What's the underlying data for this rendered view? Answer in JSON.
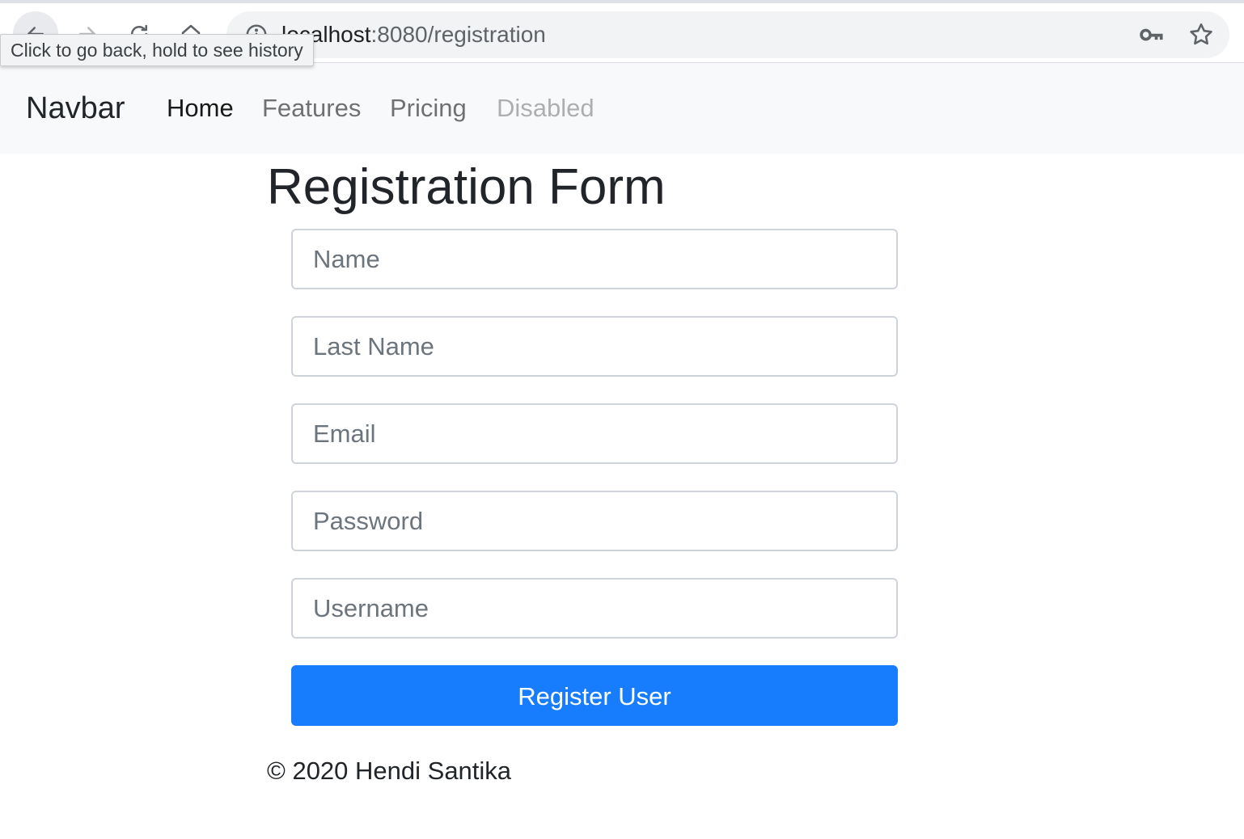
{
  "browser": {
    "url_host": "localhost",
    "url_rest": ":8080/registration",
    "tooltip": "Click to go back, hold to see history"
  },
  "navbar": {
    "brand": "Navbar",
    "links": [
      {
        "label": "Home",
        "state": "active"
      },
      {
        "label": "Features",
        "state": "normal"
      },
      {
        "label": "Pricing",
        "state": "normal"
      },
      {
        "label": "Disabled",
        "state": "disabled"
      }
    ]
  },
  "form": {
    "title": "Registration Form",
    "fields": [
      {
        "placeholder": "Name",
        "value": ""
      },
      {
        "placeholder": "Last Name",
        "value": ""
      },
      {
        "placeholder": "Email",
        "value": ""
      },
      {
        "placeholder": "Password",
        "value": ""
      },
      {
        "placeholder": "Username",
        "value": ""
      }
    ],
    "submit_label": "Register User"
  },
  "footer": {
    "text": "© 2020 Hendi Santika"
  },
  "colors": {
    "primary": "#177dfc",
    "navbar_bg": "#f8f9fa",
    "input_border": "#ced4da"
  },
  "icons": [
    "back-arrow-icon",
    "forward-arrow-icon",
    "reload-icon",
    "home-icon",
    "info-icon",
    "key-icon",
    "star-icon"
  ]
}
